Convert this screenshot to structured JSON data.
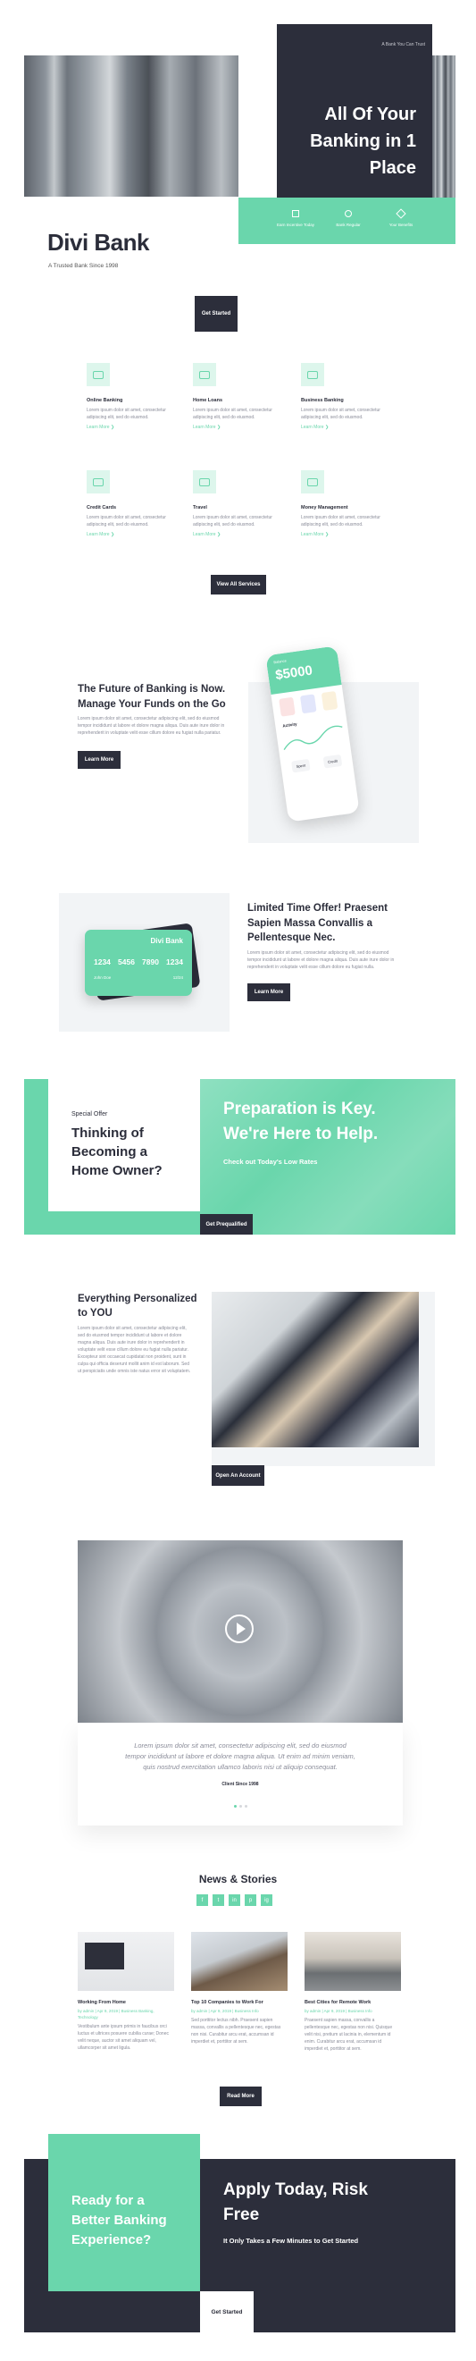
{
  "hero": {
    "top_note": "A Bank You Can Trust",
    "headline": "All Of Your Banking in 1 Place",
    "brand": "Divi Bank",
    "tagline": "A Trusted Bank Since 1998",
    "cta": "Get Started",
    "features": [
      "Earn Incentive Today",
      "Bank Regular",
      "Your Benefits"
    ]
  },
  "services": {
    "items": [
      {
        "title": "Online Banking",
        "text": "Lorem ipsum dolor sit amet, consectetur adipiscing elit, sed do eiusmod.",
        "link": "Learn More ❯"
      },
      {
        "title": "Home Loans",
        "text": "Lorem ipsum dolor sit amet, consectetur adipiscing elit, sed do eiusmod.",
        "link": "Learn More ❯"
      },
      {
        "title": "Business Banking",
        "text": "Lorem ipsum dolor sit amet, consectetur adipiscing elit, sed do eiusmod.",
        "link": "Learn More ❯"
      },
      {
        "title": "Credit Cards",
        "text": "Lorem ipsum dolor sit amet, consectetur adipiscing elit, sed do eiusmod.",
        "link": "Learn More ❯"
      },
      {
        "title": "Travel",
        "text": "Lorem ipsum dolor sit amet, consectetur adipiscing elit, sed do eiusmod.",
        "link": "Learn More ❯"
      },
      {
        "title": "Money Management",
        "text": "Lorem ipsum dolor sit amet, consectetur adipiscing elit, sed do eiusmod.",
        "link": "Learn More ❯"
      }
    ],
    "button": "View All Services"
  },
  "future": {
    "title": "The Future of Banking is Now. Manage Your Funds on the Go",
    "text": "Lorem ipsum dolor sit amet, consectetur adipiscing elit, sed do eiusmod tempor incididunt ut labore et dolore magna aliqua. Duis aute irure dolor in reprehenderit in voluptate velit esse cillum dolore eu fugiat nulla pariatur.",
    "button": "Learn More",
    "phone_balance": "$5000",
    "phone_labels": [
      "Balance",
      "Activity",
      "Spent",
      "Credit"
    ]
  },
  "offer": {
    "title": "Limited Time Offer! Praesent Sapien Massa Convallis a Pellentesque Nec.",
    "text": "Lorem ipsum dolor sit amet, consectetur adipiscing elit, sed do eiusmod tempor incididunt ut labore et dolore magna aliqua. Duis aute irure dolor in reprehenderit in voluptate velit esse cillum dolore eu fugiat nulla.",
    "button": "Learn More",
    "card_brand": "Divi Bank",
    "card_number": [
      "1234",
      "5456",
      "7890",
      "1234"
    ],
    "card_name": "John Doe",
    "card_exp": "12/24"
  },
  "home": {
    "kicker": "Special Offer",
    "title": "Thinking of Becoming a Home Owner?",
    "headline": "Preparation is Key. We're Here to Help.",
    "sub": "Check out Today's Low Rates",
    "button": "Get Prequalified"
  },
  "personal": {
    "title": "Everything Personalized to YOU",
    "text": "Lorem ipsum dolor sit amet, consectetur adipiscing elit, sed do eiusmod tempor incididunt ut labore et dolore magna aliqua. Duis aute irure dolor in reprehenderit in voluptate velit esse cillum dolore eu fugiat nulla pariatur. Excepteur sint occaecat cupidatat non proident, sunt in culpa qui officia deserunt mollit anim id est laborum. Sed ut perspiciatis unde omnis iste natus error sit voluptatem.",
    "button": "Open An Account"
  },
  "testimonial": {
    "quote": "Lorem ipsum dolor sit amet, consectetur adipiscing elit, sed do eiusmod tempor incididunt ut labore et dolore magna aliqua. Ut enim ad minim veniam, quis nostrud exercitation ullamco laboris nisi ut aliquip consequat.",
    "author": "Client Since 1998"
  },
  "news": {
    "title": "News & Stories",
    "social": [
      "f",
      "t",
      "in",
      "p",
      "ig"
    ],
    "items": [
      {
        "title": "Working From Home",
        "meta": "by admin | Apr 9, 2019 | Business Banking, Technology",
        "text": "Vestibulum ante ipsum primis in faucibus orci luctus et ultrices posuere cubilia curae; Donec velit neque, auctor sit amet aliquam vel, ullamcorper sit amet ligula."
      },
      {
        "title": "Top 10 Companies to Work For",
        "meta": "by admin | Apr 9, 2019 | Business Info",
        "text": "Sed porttitor lectus nibh. Praesent sapien massa, convallis a pellentesque nec, egestas non nisi. Curabitur arcu erat, accumsan id imperdiet et, porttitor at sem."
      },
      {
        "title": "Best Cities for Remote Work",
        "meta": "by admin | Apr 9, 2019 | Business Info",
        "text": "Praesent sapien massa, convallis a pellentesque nec, egestas non nisi. Quisque velit nisi, pretium ut lacinia in, elementum id enim. Curabitur arcu erat, accumsan id imperdiet et, porttitor at sem."
      }
    ],
    "button": "Read More"
  },
  "footer_cta": {
    "left": "Ready for a Better Banking Experience?",
    "headline": "Apply Today, Risk Free",
    "sub": "It Only Takes a Few Minutes to Get Started",
    "button": "Get Started"
  }
}
